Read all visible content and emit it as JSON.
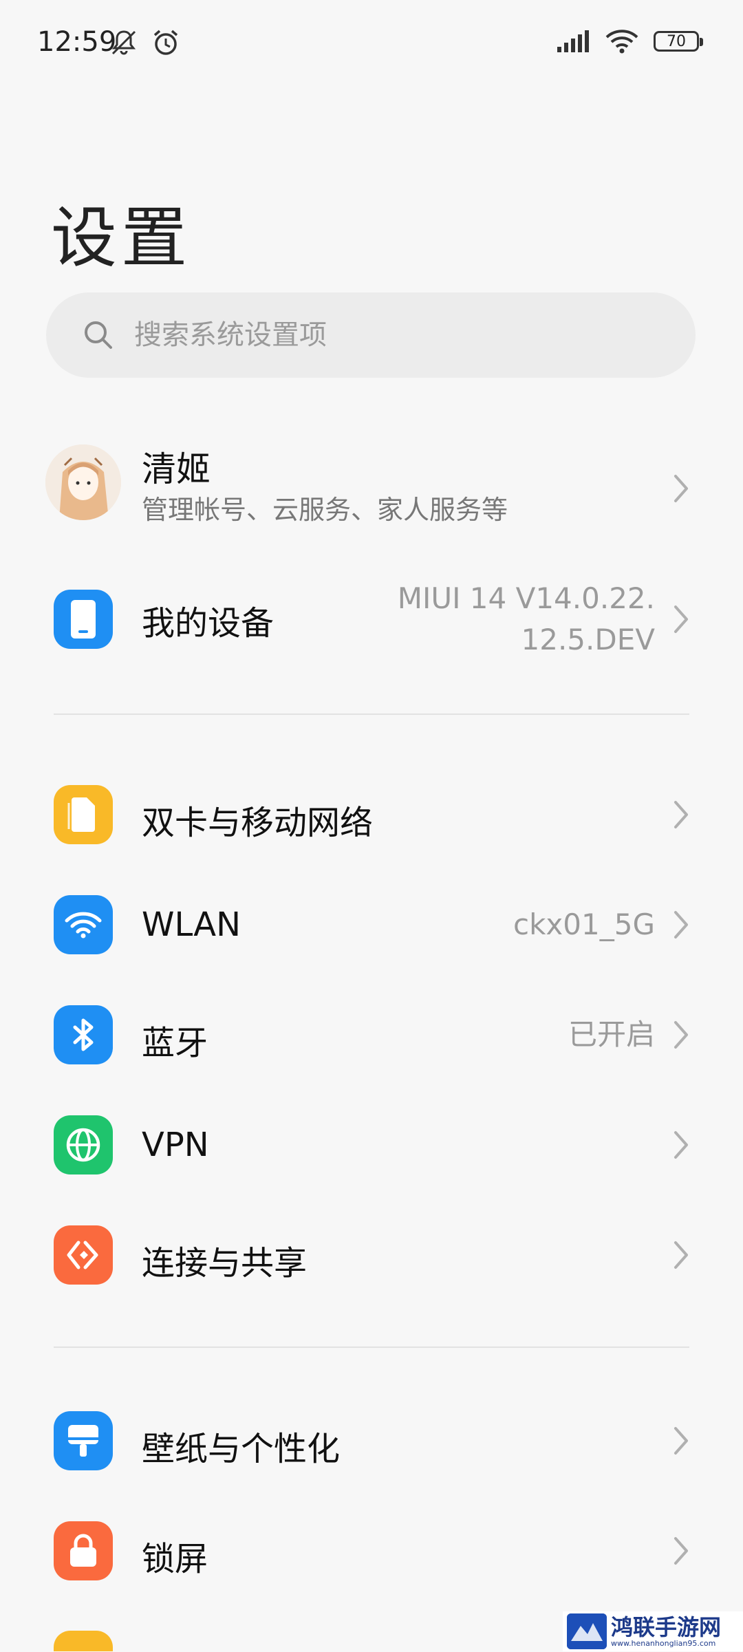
{
  "status_bar": {
    "time": "12:59",
    "battery": "70"
  },
  "page": {
    "title": "设置"
  },
  "search": {
    "placeholder": "搜索系统设置项"
  },
  "profile": {
    "name": "清姬",
    "subtitle": "管理帐号、云服务、家人服务等"
  },
  "my_device": {
    "label": "我的设备",
    "value_line1": "MIUI 14 V14.0.22.",
    "value_line2": "12.5.DEV"
  },
  "items": [
    {
      "label": "双卡与移动网络",
      "value": "",
      "color": "#f9b928",
      "icon": "sim-card-icon"
    },
    {
      "label": "WLAN",
      "value": "ckx01_5G",
      "color": "#1f8ff3",
      "icon": "wifi-icon"
    },
    {
      "label": "蓝牙",
      "value": "已开启",
      "color": "#1f8ff3",
      "icon": "bluetooth-icon"
    },
    {
      "label": "VPN",
      "value": "",
      "color": "#1fc46d",
      "icon": "globe-icon"
    },
    {
      "label": "连接与共享",
      "value": "",
      "color": "#fa6a3e",
      "icon": "connection-share-icon"
    },
    {
      "label": "壁纸与个性化",
      "value": "",
      "color": "#1f8ff3",
      "icon": "wallpaper-icon"
    },
    {
      "label": "锁屏",
      "value": "",
      "color": "#fa6a3e",
      "icon": "lock-icon"
    }
  ],
  "watermark": {
    "title": "鸿联手游网",
    "url": "www.henanhonglian95.com"
  }
}
